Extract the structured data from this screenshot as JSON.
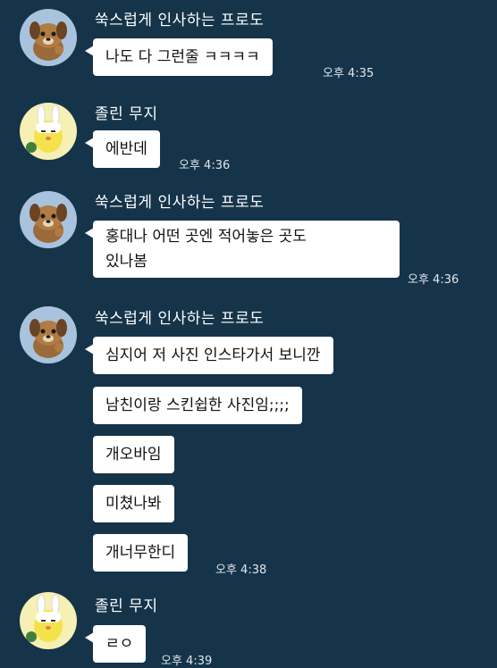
{
  "chat": {
    "messages": [
      {
        "sender": "쑥스럽게 인사하는 프로도",
        "avatar": "frodo-avatar",
        "bubbles": [
          "나도 다 그런줄 ㅋㅋㅋㅋ"
        ],
        "time": "오후 4:35"
      },
      {
        "sender": "졸린 무지",
        "avatar": "muzi-avatar",
        "bubbles": [
          "에반데"
        ],
        "time": "오후 4:36"
      },
      {
        "sender": "쑥스럽게 인사하는 프로도",
        "avatar": "frodo-avatar",
        "bubbles": [
          "홍대나 어떤 곳엔 적어놓은 곳도\n있나봄"
        ],
        "time": "오후 4:36"
      },
      {
        "sender": "쑥스럽게 인사하는 프로도",
        "avatar": "frodo-avatar",
        "bubbles": [
          "심지어 저 사진 인스타가서 보니깐",
          "남친이랑 스킨쉽한 사진임;;;;",
          "개오바임",
          "미쳤나봐",
          "개너무한디"
        ],
        "time": "오후 4:38"
      },
      {
        "sender": "졸린 무지",
        "avatar": "muzi-avatar",
        "bubbles": [
          "ㄹㅇ"
        ],
        "time": "오후 4:39"
      }
    ]
  },
  "colors": {
    "background": "#15344a",
    "bubble": "#ffffff",
    "name_text": "#ffffff",
    "time_text": "#dfe6ec"
  }
}
